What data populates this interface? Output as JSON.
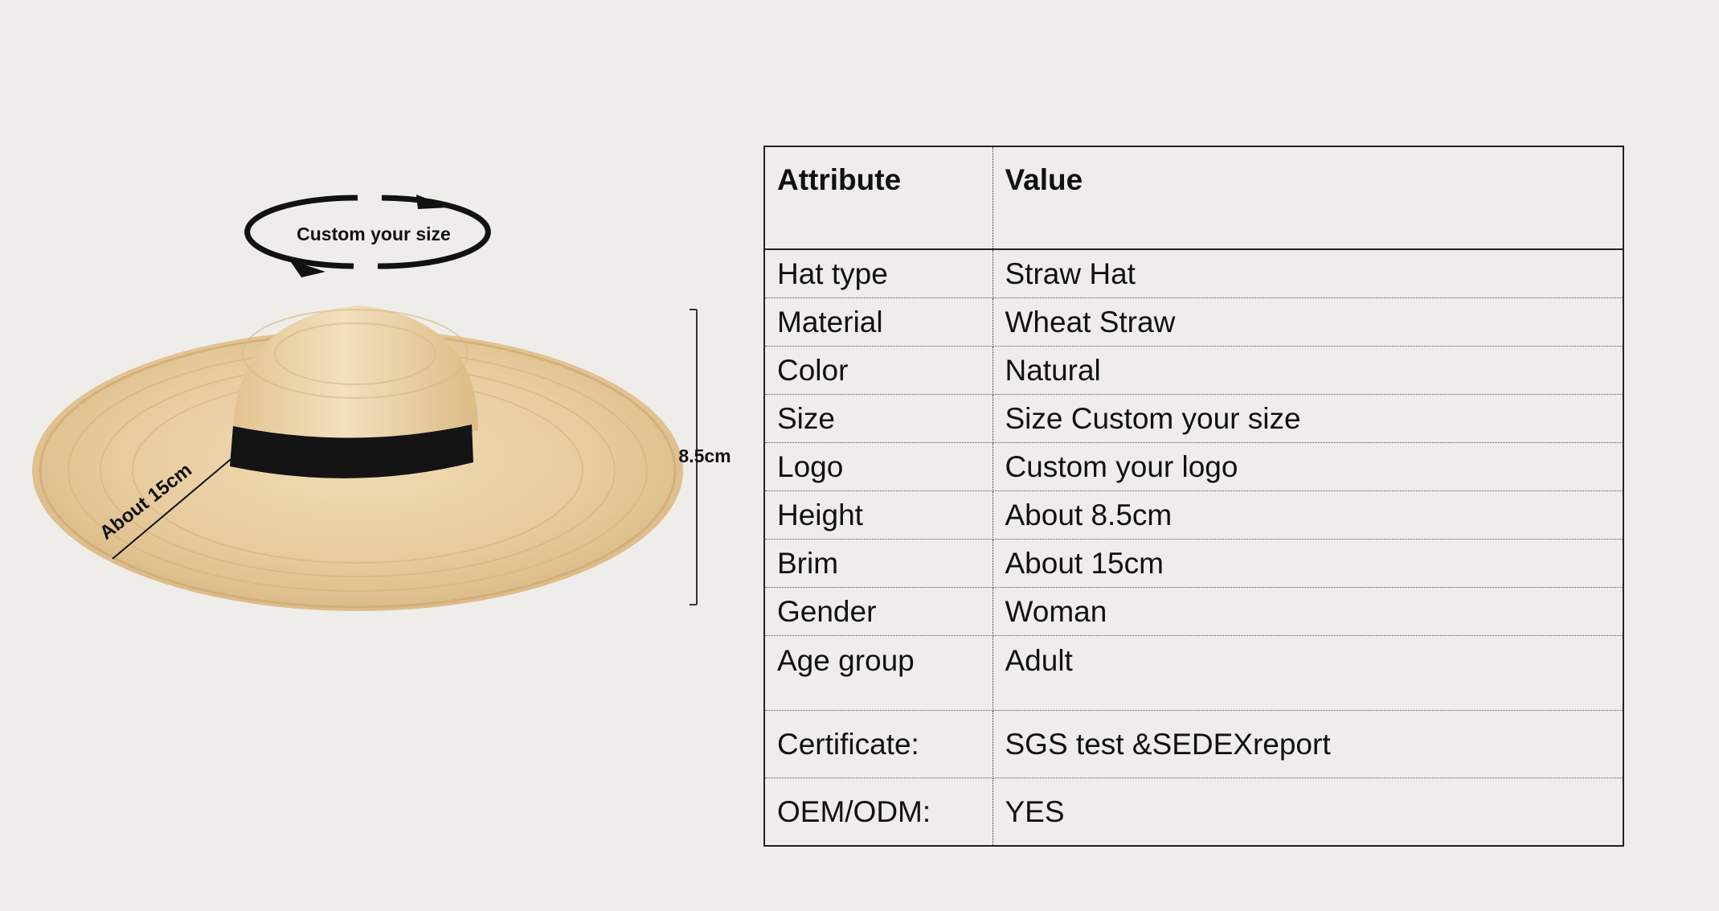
{
  "figure": {
    "size_badge": "Custom your size",
    "height_label": "8.5cm",
    "brim_label": "About  15cm"
  },
  "table": {
    "headers": [
      "Attribute",
      "Value"
    ],
    "rows": [
      {
        "attribute": "Hat type",
        "value": "Straw Hat"
      },
      {
        "attribute": "Material",
        "value": "Wheat Straw"
      },
      {
        "attribute": "Color",
        "value": "Natural"
      },
      {
        "attribute": "Size",
        "value": "Size Custom your size"
      },
      {
        "attribute": "Logo",
        "value": "Custom your logo"
      },
      {
        "attribute": "Height",
        "value": "About 8.5cm"
      },
      {
        "attribute": "Brim",
        "value": "About 15cm"
      },
      {
        "attribute": "Gender",
        "value": "Woman"
      },
      {
        "attribute": "Age group",
        "value": "Adult"
      },
      {
        "attribute": "Certificate:",
        "value": "SGS test &SEDEXreport"
      },
      {
        "attribute": "OEM/ODM:",
        "value": "YES"
      }
    ]
  },
  "colors": {
    "background": "#efede9",
    "straw": "#e6c99a",
    "band": "#141414"
  }
}
